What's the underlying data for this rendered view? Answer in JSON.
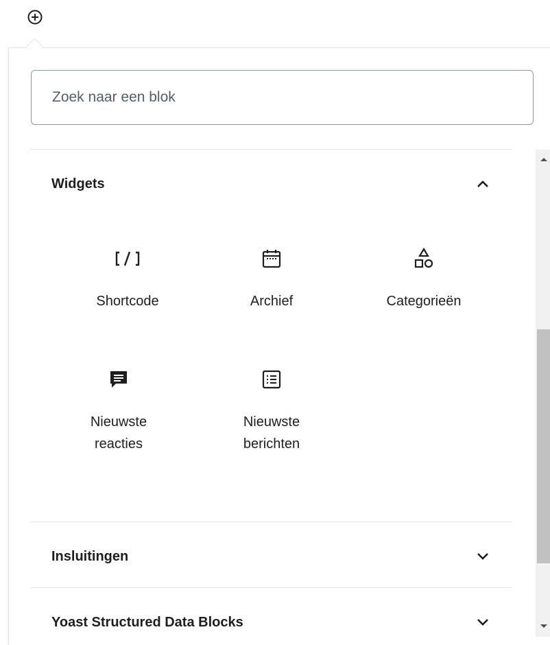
{
  "search": {
    "placeholder": "Zoek naar een blok"
  },
  "panels": [
    {
      "title": "Widgets",
      "expanded": true
    },
    {
      "title": "Insluitingen",
      "expanded": false
    },
    {
      "title": "Yoast Structured Data Blocks",
      "expanded": false
    }
  ],
  "widgets": {
    "blocks": [
      {
        "label": "Shortcode",
        "icon": "shortcode-icon"
      },
      {
        "label": "Archief",
        "icon": "calendar-icon"
      },
      {
        "label": "Categorieën",
        "icon": "categories-icon"
      },
      {
        "label_line1": "Nieuwste",
        "label_line2": "reacties",
        "icon": "comment-icon"
      },
      {
        "label_line1": "Nieuwste",
        "label_line2": "berichten",
        "icon": "list-icon"
      }
    ]
  },
  "colors": {
    "text": "#1e1e1e",
    "border": "#8d96a0",
    "divider": "#e2e4e7",
    "placeholder": "#555d66"
  }
}
